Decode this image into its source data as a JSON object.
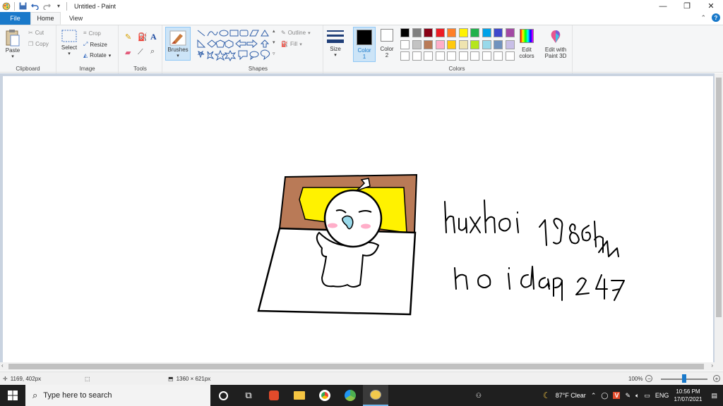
{
  "window": {
    "title": "Untitled - Paint"
  },
  "menu": {
    "file": "File",
    "home": "Home",
    "view": "View"
  },
  "ribbon": {
    "clipboard": {
      "label": "Clipboard",
      "paste": "Paste",
      "cut": "Cut",
      "copy": "Copy"
    },
    "image": {
      "label": "Image",
      "select": "Select",
      "crop": "Crop",
      "resize": "Resize",
      "rotate": "Rotate"
    },
    "tools": {
      "label": "Tools"
    },
    "brushes": {
      "label": "Brushes"
    },
    "shapes": {
      "label": "Shapes",
      "outline": "Outline",
      "fill": "Fill"
    },
    "size": {
      "label": "Size"
    },
    "color1": {
      "label": "Color",
      "num": "1"
    },
    "color2": {
      "label": "Color",
      "num": "2"
    },
    "colors": {
      "label": "Colors",
      "edit": "Edit colors",
      "edit_line1": "Edit",
      "edit_line2": "colors",
      "paint3d_line1": "Edit with",
      "paint3d_line2": "Paint 3D",
      "row1": [
        "#000000",
        "#7f7f7f",
        "#880015",
        "#ed1c24",
        "#ff7f27",
        "#fff200",
        "#22b14c",
        "#00a2e8",
        "#3f48cc",
        "#a349a4"
      ],
      "row2": [
        "#ffffff",
        "#c3c3c3",
        "#b97a57",
        "#ffaec9",
        "#ffc90e",
        "#efe4b0",
        "#b5e61d",
        "#99d9ea",
        "#7092be",
        "#c8bfe7"
      ],
      "row3": [
        "#ffffff",
        "#ffffff",
        "#ffffff",
        "#ffffff",
        "#ffffff",
        "#ffffff",
        "#ffffff",
        "#ffffff",
        "#ffffff",
        "#ffffff"
      ],
      "primary": "#000000",
      "secondary": "#ffffff"
    }
  },
  "status": {
    "cursor": "1169, 402px",
    "canvas_size": "1360 × 621px",
    "zoom": "100%"
  },
  "taskbar": {
    "search_placeholder": "Type here to search",
    "weather": "87°F  Clear",
    "lang": "ENG",
    "time": "10:56 PM",
    "date": "17/07/2021"
  }
}
